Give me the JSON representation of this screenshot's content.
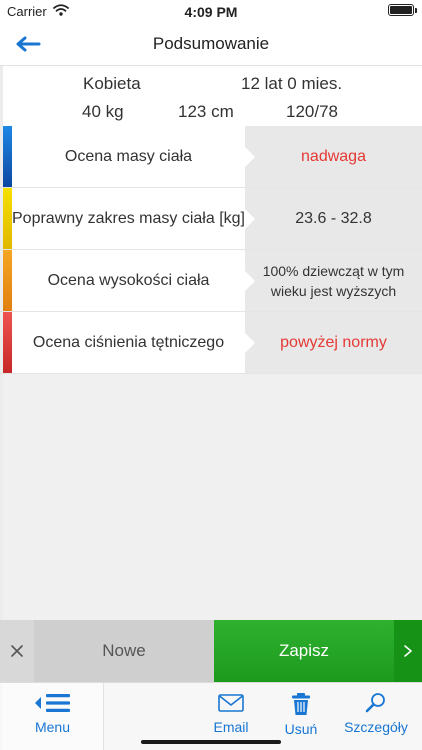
{
  "status_bar": {
    "carrier": "Carrier",
    "time": "4:09 PM"
  },
  "header": {
    "title": "Podsumowanie"
  },
  "patient": {
    "sex": "Kobieta",
    "age": "12 lat 0 mies.",
    "weight": "40 kg",
    "height": "123 cm",
    "blood_pressure": "120/78"
  },
  "results": [
    {
      "label": "Ocena masy ciała",
      "value": "nadwaga",
      "color": "#1565c0",
      "alert": true
    },
    {
      "label": "Poprawny zakres masy ciała [kg]",
      "value": "23.6 - 32.8",
      "color": "#f2d600",
      "alert": false
    },
    {
      "label": "Ocena wysokości ciała",
      "value": "100% dziewcząt w tym wieku jest wyższych",
      "color": "#ef9a1a",
      "alert": false
    },
    {
      "label": "Ocena ciśnienia tętniczego",
      "value": "powyżej normy",
      "color": "#e53935",
      "alert": true
    }
  ],
  "actions": {
    "new_label": "Nowe",
    "save_label": "Zapisz"
  },
  "tabs": {
    "menu": "Menu",
    "email": "Email",
    "delete": "Usuń",
    "details": "Szczegóły"
  },
  "colors": {
    "accent": "#1976d2",
    "save_green": "#22a622",
    "alert_red": "#e53935"
  }
}
